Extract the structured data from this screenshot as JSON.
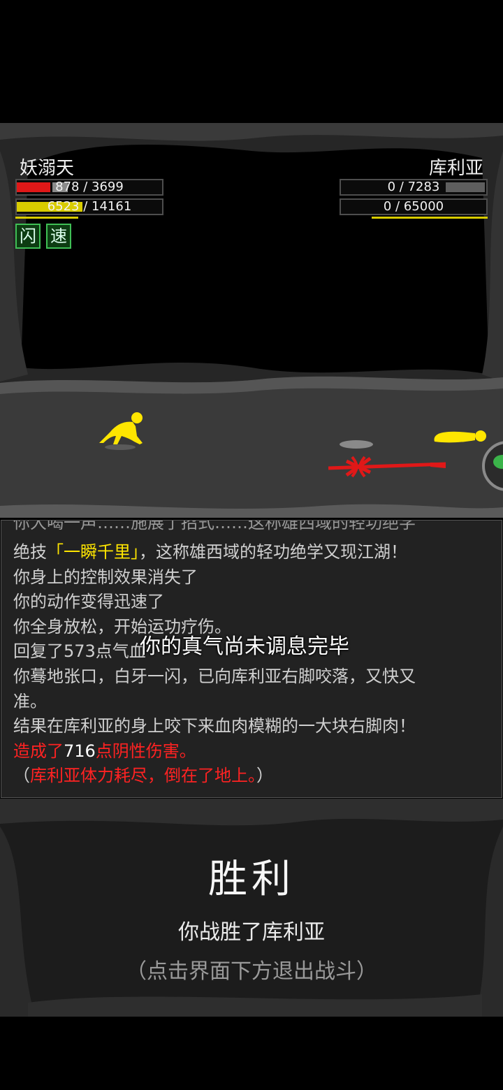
{
  "player": {
    "name": "妖溺天",
    "hp_text": "878 / 3699",
    "hp_ratio": 0.237,
    "hp_color": "#e01818",
    "qi_text": "6523 / 14161",
    "qi_ratio": 0.461,
    "qi_color": "#d8cc00",
    "statuses": [
      "闪",
      "速"
    ]
  },
  "enemy": {
    "name": "库利亚",
    "hp_text": "0 / 7283",
    "hp_ratio": 0.0,
    "qi_text": "0 / 65000",
    "qi_ratio": 0.0
  },
  "log": {
    "partial_line": "你大喝一声……施展了招式……这称雄西域的轻功绝学",
    "lines": [
      {
        "parts": [
          {
            "t": "绝技",
            "c": "normal"
          },
          {
            "t": "「一瞬千里」",
            "c": "yellow"
          },
          {
            "t": "，这称雄西域的轻功绝学又现江湖！",
            "c": "normal"
          }
        ]
      },
      {
        "parts": [
          {
            "t": "你身上的控制效果消失了",
            "c": "normal"
          }
        ]
      },
      {
        "parts": [
          {
            "t": "你的动作变得迅速了",
            "c": "normal"
          }
        ]
      },
      {
        "parts": [
          {
            "t": "你全身放松，开始运功疗伤。",
            "c": "normal"
          }
        ]
      },
      {
        "parts": [
          {
            "t": "回复了573点气血",
            "c": "normal"
          }
        ]
      },
      {
        "parts": [
          {
            "t": "你蓦地张口，白牙一闪，已向库利亚右脚咬落，又快又",
            "c": "normal"
          }
        ]
      },
      {
        "parts": [
          {
            "t": "准。",
            "c": "normal"
          }
        ]
      },
      {
        "parts": [
          {
            "t": "结果在库利亚的身上咬下来血肉模糊的一大块右脚肉！",
            "c": "normal"
          }
        ]
      },
      {
        "parts": [
          {
            "t": "造成了",
            "c": "red"
          },
          {
            "t": "716",
            "c": "white"
          },
          {
            "t": "点阴性伤害。",
            "c": "red"
          }
        ]
      },
      {
        "parts": [
          {
            "t": "（",
            "c": "normal"
          },
          {
            "t": "库利亚体力耗尽，倒在了地上。",
            "c": "red"
          },
          {
            "t": "）",
            "c": "normal"
          }
        ]
      }
    ],
    "toast": "你的真气尚未调息完毕"
  },
  "victory": {
    "title": "胜利",
    "subtitle": "你战胜了库利亚",
    "hint": "（点击界面下方退出战斗）"
  }
}
